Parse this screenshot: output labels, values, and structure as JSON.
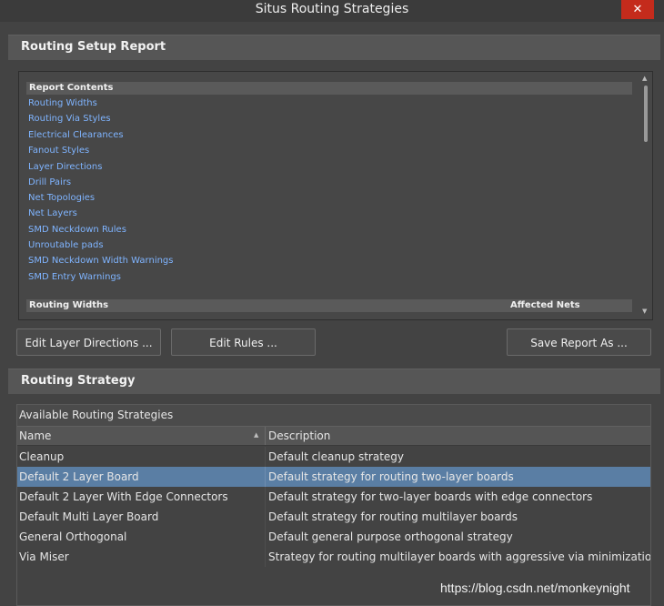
{
  "window": {
    "title": "Situs Routing Strategies"
  },
  "setup_section": {
    "title": "Routing Setup Report"
  },
  "report": {
    "contents_header": "Report Contents",
    "links": [
      "Routing Widths",
      "Routing Via Styles",
      "Electrical Clearances",
      "Fanout Styles",
      "Layer Directions",
      "Drill Pairs",
      "Net Topologies",
      "Net Layers",
      "SMD Neckdown Rules",
      "Unroutable pads",
      "SMD Neckdown Width Warnings",
      "SMD Entry Warnings"
    ],
    "table_header_left": "Routing Widths",
    "table_header_right": "Affected Nets"
  },
  "buttons": {
    "edit_layer_directions": "Edit Layer Directions ...",
    "edit_rules": "Edit Rules ...",
    "save_report_as": "Save Report As ..."
  },
  "strategy_section": {
    "title": "Routing Strategy"
  },
  "strategies": {
    "caption": "Available Routing Strategies",
    "col_name": "Name",
    "col_description": "Description",
    "selected_index": 1,
    "rows": [
      {
        "name": "Cleanup",
        "description": "Default cleanup strategy"
      },
      {
        "name": "Default 2 Layer Board",
        "description": "Default strategy for routing two-layer boards"
      },
      {
        "name": "Default 2 Layer With Edge Connectors",
        "description": "Default strategy for two-layer boards with edge connectors"
      },
      {
        "name": "Default Multi Layer Board",
        "description": "Default strategy for routing multilayer boards"
      },
      {
        "name": "General Orthogonal",
        "description": "Default general purpose orthogonal strategy"
      },
      {
        "name": "Via Miser",
        "description": "Strategy for routing multilayer boards with aggressive via minimization"
      }
    ]
  },
  "watermark": "https://blog.csdn.net/monkeynight",
  "colors": {
    "background": "#434343",
    "selection": "#5a7ea4",
    "link": "#7fb4ff",
    "close_button": "#c42b1c"
  },
  "icons": {
    "close": "close-icon",
    "sort": "sort-ascending-icon",
    "scroll_up": "scroll-up-arrow-icon",
    "scroll_down": "scroll-down-arrow-icon"
  }
}
